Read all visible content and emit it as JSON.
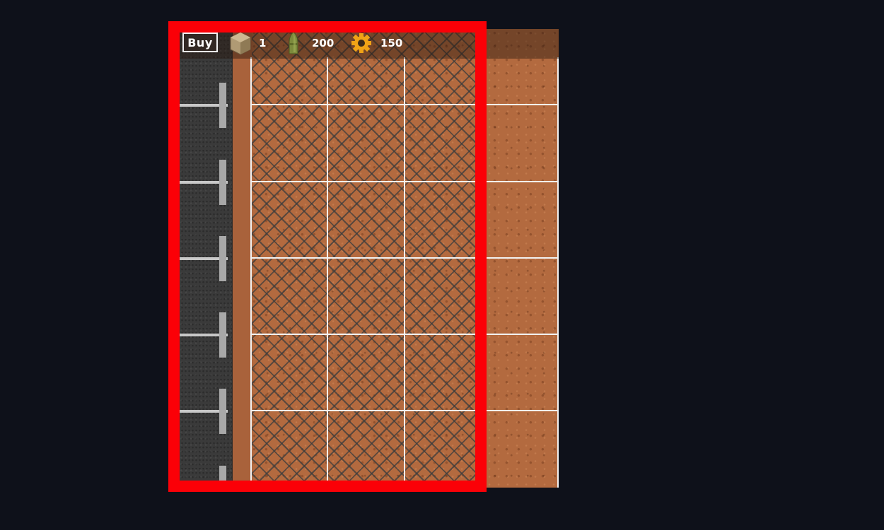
{
  "hud": {
    "buy_label": "Buy",
    "crates": {
      "icon": "crate-icon",
      "value": "1"
    },
    "ammo": {
      "icon": "bullet-icon",
      "value": "200"
    },
    "parts": {
      "icon": "gear-icon",
      "value": "150"
    }
  },
  "colors": {
    "frame": "#fb0007",
    "dirt": "#b36a3f",
    "road": "#3a3a3a",
    "background": "#0e111a"
  }
}
